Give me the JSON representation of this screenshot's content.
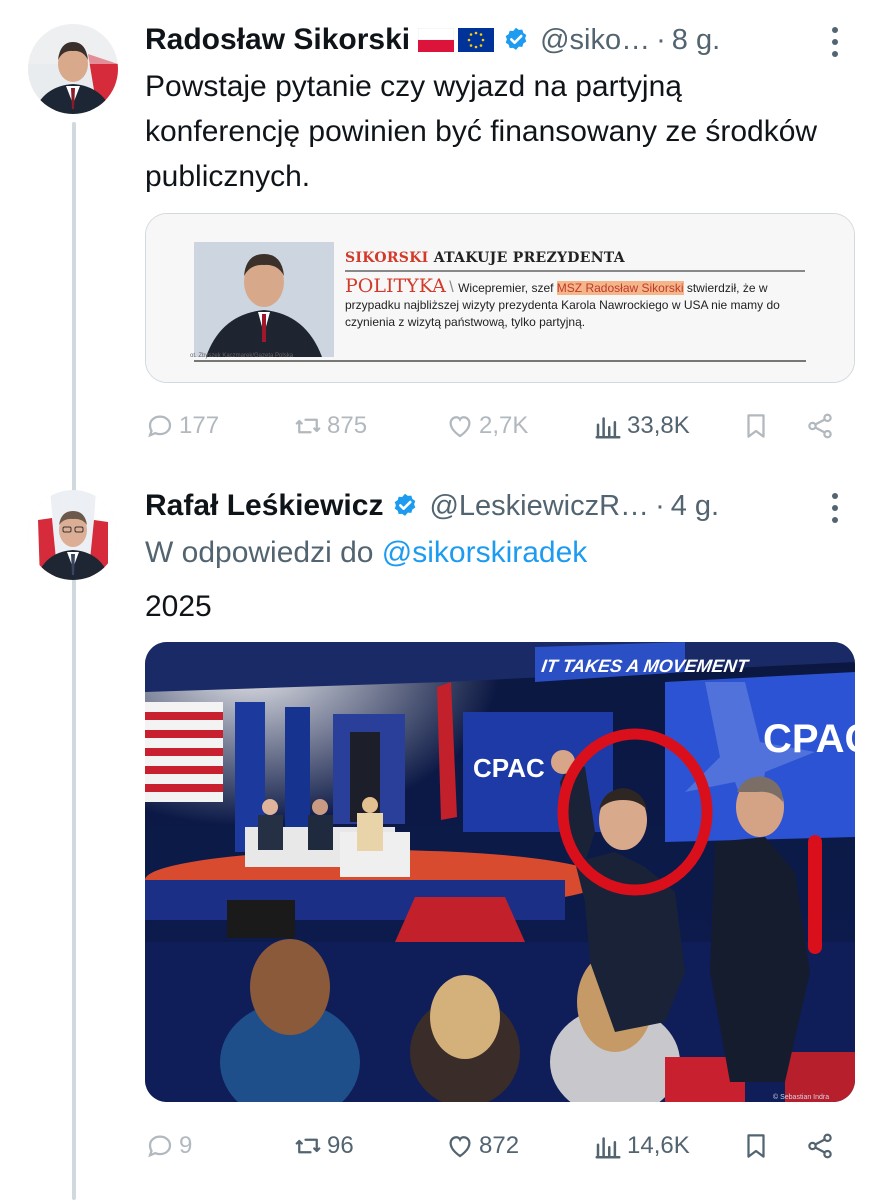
{
  "tweet1": {
    "name": "Radosław Sikorski",
    "handle": "@siko…",
    "time": "8 g.",
    "text": "Powstaje pytanie czy wyjazd na partyjną konferencję powinien być finansowany ze środków publicznych.",
    "card": {
      "headline_red": "SIKORSKI",
      "headline_rest": " ATAKUJE PREZYDENTA",
      "section": "POLITYKA",
      "lead_before": "Wicepremier, szef ",
      "lead_highlight": "MSZ Radosław Sikorski",
      "lead_after": "stwierdził, że w przypadku najbliższej wizyty prezydenta Karola Nawrockiego w USA nie mamy do czynienia z wizytą państwową, tylko partyjną.",
      "photo_credit": "ot. Zbyszek Kaczmarek/Gazeta Polska"
    },
    "replies": "177",
    "reposts": "875",
    "likes": "2,7K",
    "views": "33,8K"
  },
  "tweet2": {
    "name": "Rafał Leśkiewicz",
    "handle": "@LeskiewiczR…",
    "time": "4 g.",
    "reply_prefix": "W odpowiedzi do ",
    "reply_to": "@sikorskiradek",
    "text": "2025",
    "photo": {
      "stage_text": "IT TAKES A MOVEMENT",
      "brand": "CPAC",
      "credit": "© Sebastian Indra"
    },
    "replies": "9",
    "reposts": "96",
    "likes": "872",
    "views": "14,6K"
  },
  "colors": {
    "accent": "#1d9bf0",
    "muted": "#536471",
    "text": "#0f1419",
    "verified": "#1d9bf0",
    "circle": "#d9101c"
  }
}
